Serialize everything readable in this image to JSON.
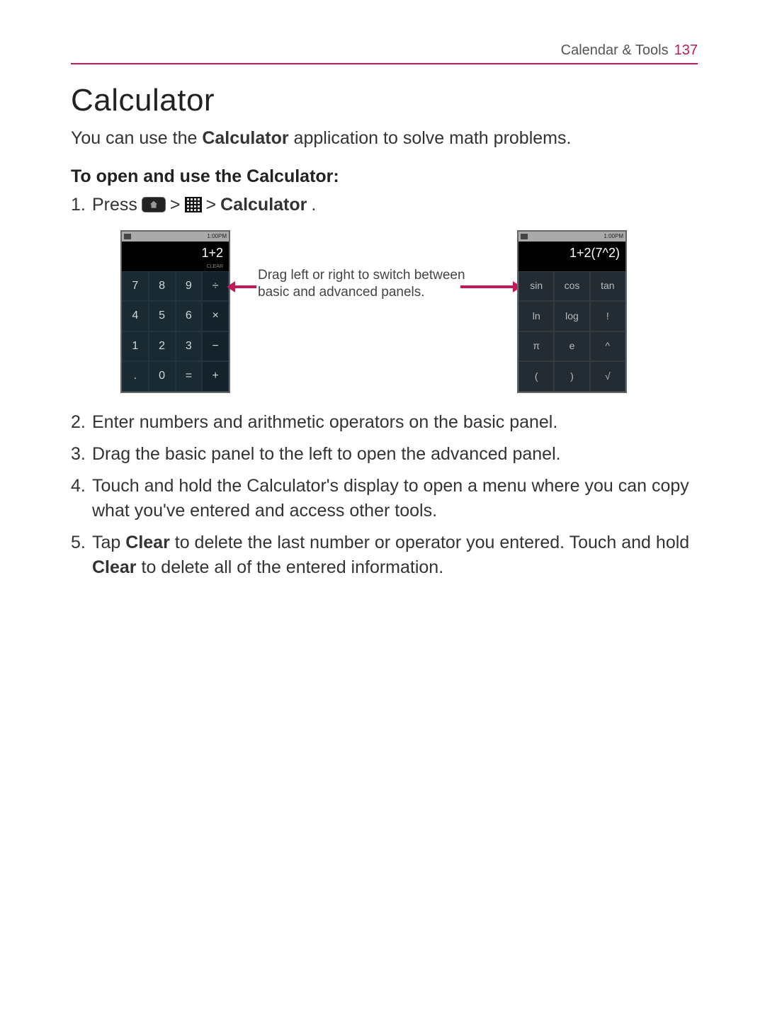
{
  "header": {
    "section": "Calendar & Tools",
    "page": "137"
  },
  "title": "Calculator",
  "intro_prefix": "You can use the ",
  "intro_bold": "Calculator",
  "intro_suffix": " application to solve math problems.",
  "subhead": "To open and use the Calculator:",
  "step1": {
    "press": "Press",
    "gt": ">",
    "calc": "Calculator",
    "dot": "."
  },
  "annotation": "Drag left or right to switch between basic and advanced panels.",
  "basic_phone": {
    "status_time": "1:00PM",
    "display": "1+2",
    "clear": "CLEAR",
    "keys": [
      [
        "7",
        "8",
        "9",
        "÷"
      ],
      [
        "4",
        "5",
        "6",
        "×"
      ],
      [
        "1",
        "2",
        "3",
        "−"
      ],
      [
        ".",
        "0",
        "=",
        "+"
      ]
    ]
  },
  "adv_phone": {
    "status_time": "1:00PM",
    "display": "1+2(7^2)",
    "keys": [
      [
        "sin",
        "cos",
        "tan"
      ],
      [
        "ln",
        "log",
        "!"
      ],
      [
        "π",
        "e",
        "^"
      ],
      [
        "(",
        ")",
        "√"
      ]
    ]
  },
  "steps_rest": [
    "Enter numbers and arithmetic operators on the basic panel.",
    "Drag the basic panel to the left to open the advanced panel.",
    "Touch and hold the Calculator's display to open a menu where you can copy what you've entered and access other tools."
  ],
  "step5": {
    "p1": "Tap ",
    "b1": "Clear",
    "p2": " to delete the last number or operator you entered. Touch and hold ",
    "b2": "Clear",
    "p3": " to delete all of the entered information."
  }
}
